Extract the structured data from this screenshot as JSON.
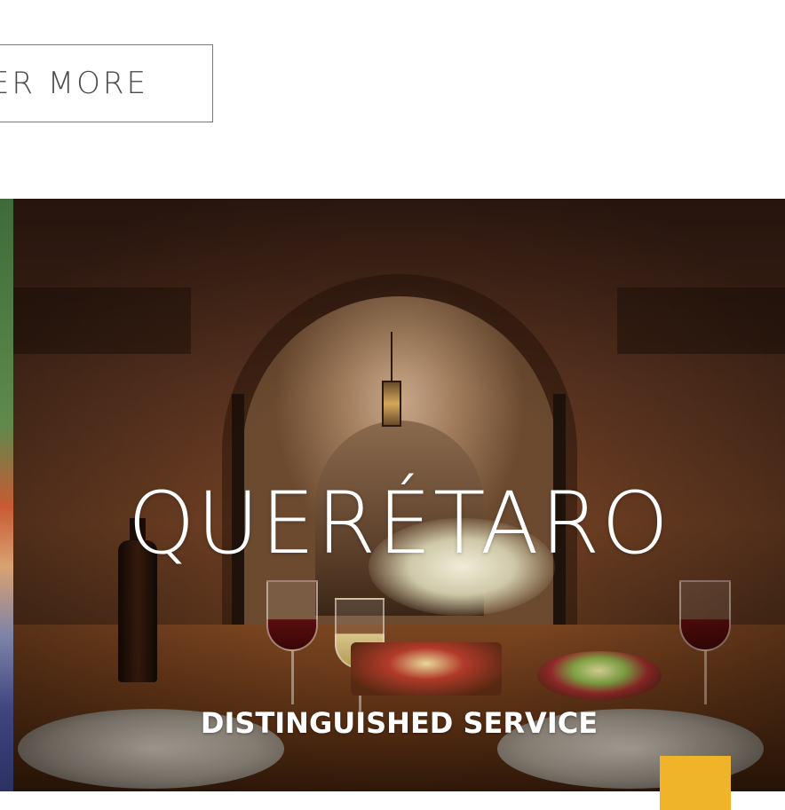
{
  "discover": {
    "label": "VER MORE"
  },
  "hero": {
    "title": "QUERÉTARO",
    "subtitle": "DISTINGUISHED SERVICE"
  },
  "colors": {
    "accent": "#f0b42b",
    "button_border": "#7a7a7a",
    "button_text": "#4a4a4a",
    "hero_text": "#ffffff"
  }
}
